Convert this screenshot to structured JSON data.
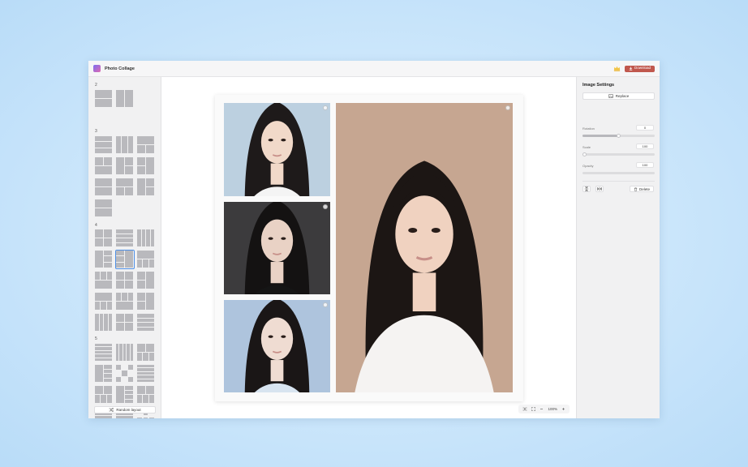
{
  "app": {
    "title": "Photo Collage",
    "download_label": "Download"
  },
  "layouts": {
    "sections": [
      {
        "label": "2"
      },
      {
        "label": "3"
      },
      {
        "label": "4"
      },
      {
        "label": "5"
      }
    ],
    "random_label": "Random layout"
  },
  "canvas": {
    "photos": [
      {
        "name": "photo-top-left",
        "colors": {
          "bg": "#bcd0e0",
          "hair": "#1e1a1a",
          "skin": "#f1d9c9",
          "cloth": "#f4f4f4"
        }
      },
      {
        "name": "photo-middle-left",
        "colors": {
          "bg": "#3c3b3d",
          "hair": "#141212",
          "skin": "#e9d2c5",
          "cloth": "#151515"
        }
      },
      {
        "name": "photo-bottom-left",
        "colors": {
          "bg": "#aec4dd",
          "hair": "#1a1616",
          "skin": "#efdcd2",
          "cloth": "#d8e4f0"
        }
      },
      {
        "name": "photo-right",
        "colors": {
          "bg": "#c6a691",
          "hair": "#1c1614",
          "skin": "#f0d2c0",
          "cloth": "#f5f3f2"
        }
      }
    ]
  },
  "zoom": {
    "level": "100%"
  },
  "settings": {
    "title": "Image Settings",
    "replace_label": "Replace",
    "rotation": {
      "label": "Rotation",
      "value": "0"
    },
    "scale": {
      "label": "Scale",
      "value": "100"
    },
    "opacity": {
      "label": "Opacity",
      "value": "100"
    },
    "delete_label": "Delete"
  },
  "colors": {
    "accent": "#c0574d",
    "selection": "#4d8fe6"
  }
}
